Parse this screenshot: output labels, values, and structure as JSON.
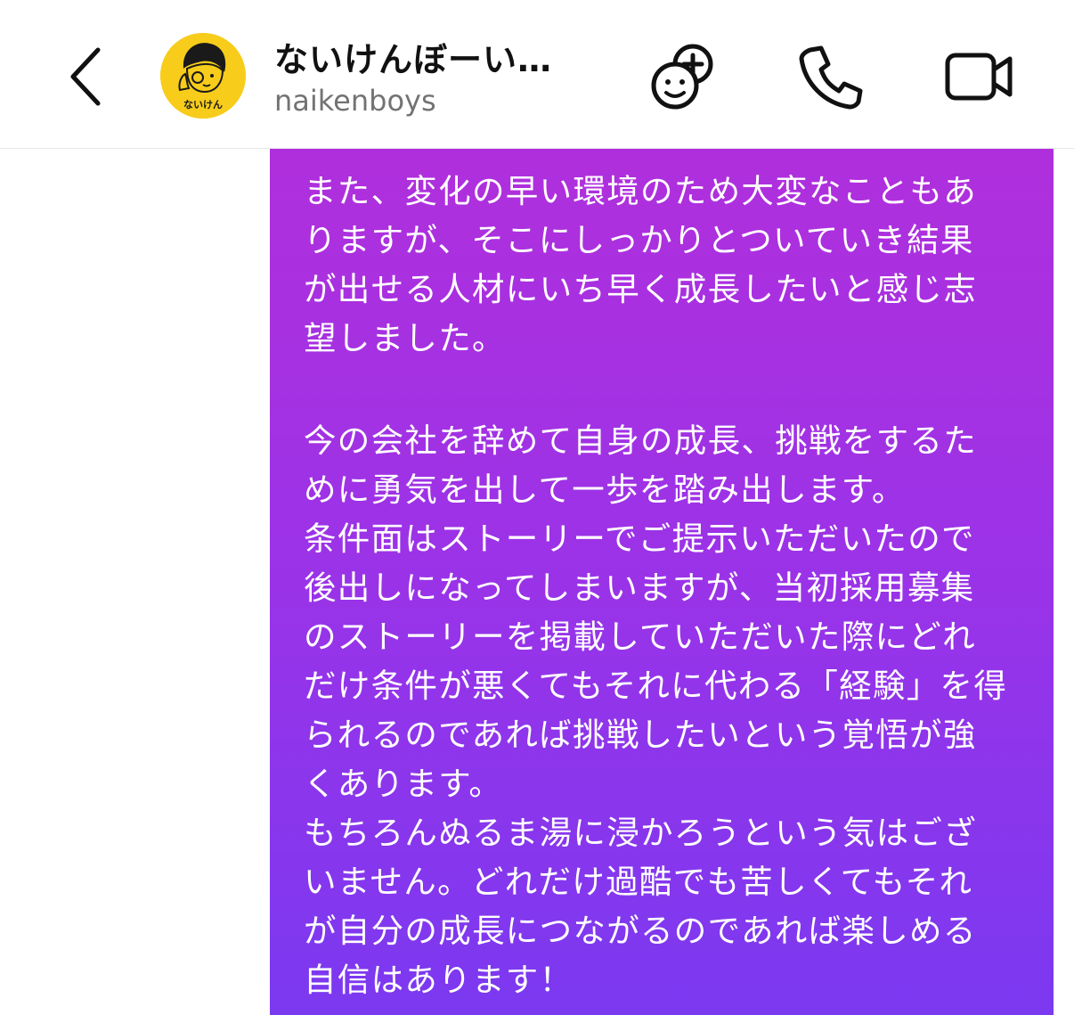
{
  "header": {
    "name": "ないけんぼーい…",
    "handle": "naikenboys",
    "avatar_text": "ないけん"
  },
  "icons": {
    "back": "chevron-left-icon",
    "add_group": "add-smiley-group-icon",
    "call": "phone-icon",
    "video": "video-camera-icon"
  },
  "colors": {
    "bubble_top": "#b02fdc",
    "bubble_bottom": "#7b39f0",
    "avatar_bg": "#f7cc1b"
  },
  "message": {
    "lines": [
      "また、変化の早い環境のため大変なこともあ",
      "りますが、そこにしっかりとついていき結果",
      "が出せる人材にいち早く成長したいと感じ志",
      "望しました。",
      "今の会社を辞めて自身の成長、挑戦をするた",
      "めに勇気を出して一歩を踏み出します。",
      "条件面はストーリーでご提示いただいたので",
      "後出しになってしまいますが、当初採用募集",
      "のストーリーを掲載していただいた際にどれ",
      "だけ条件が悪くてもそれに代わる「経験」を得",
      "られるのであれば挑戦したいという覚悟が強",
      "くあります。",
      "もちろんぬるま湯に浸かろうという気はござ",
      "いません。どれだけ過酷でも苦しくてもそれ",
      "が自分の成長につながるのであれば楽しめる",
      "自信はあります！"
    ]
  }
}
